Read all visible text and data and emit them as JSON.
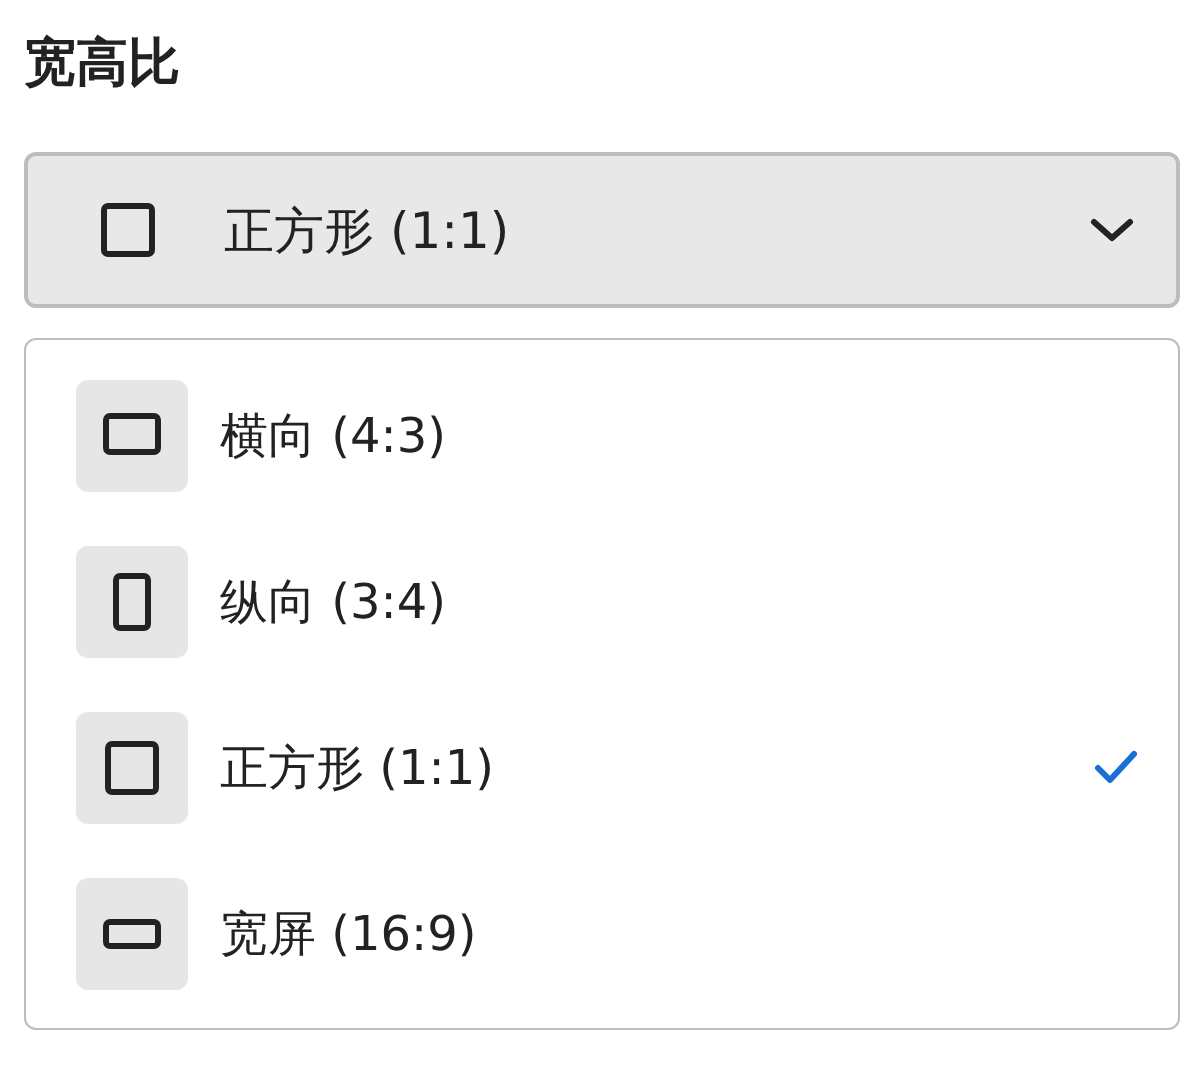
{
  "title": "宽高比",
  "dropdown": {
    "value": "正方形 (1:1)",
    "kind": "square",
    "expanded": true
  },
  "options": [
    {
      "label": "横向 (4:3)",
      "kind": "landscape",
      "selected": false
    },
    {
      "label": "纵向 (3:4)",
      "kind": "portrait",
      "selected": false
    },
    {
      "label": "正方形 (1:1)",
      "kind": "square",
      "selected": true
    },
    {
      "label": "宽屏 (16:9)",
      "kind": "wide",
      "selected": false
    }
  ]
}
